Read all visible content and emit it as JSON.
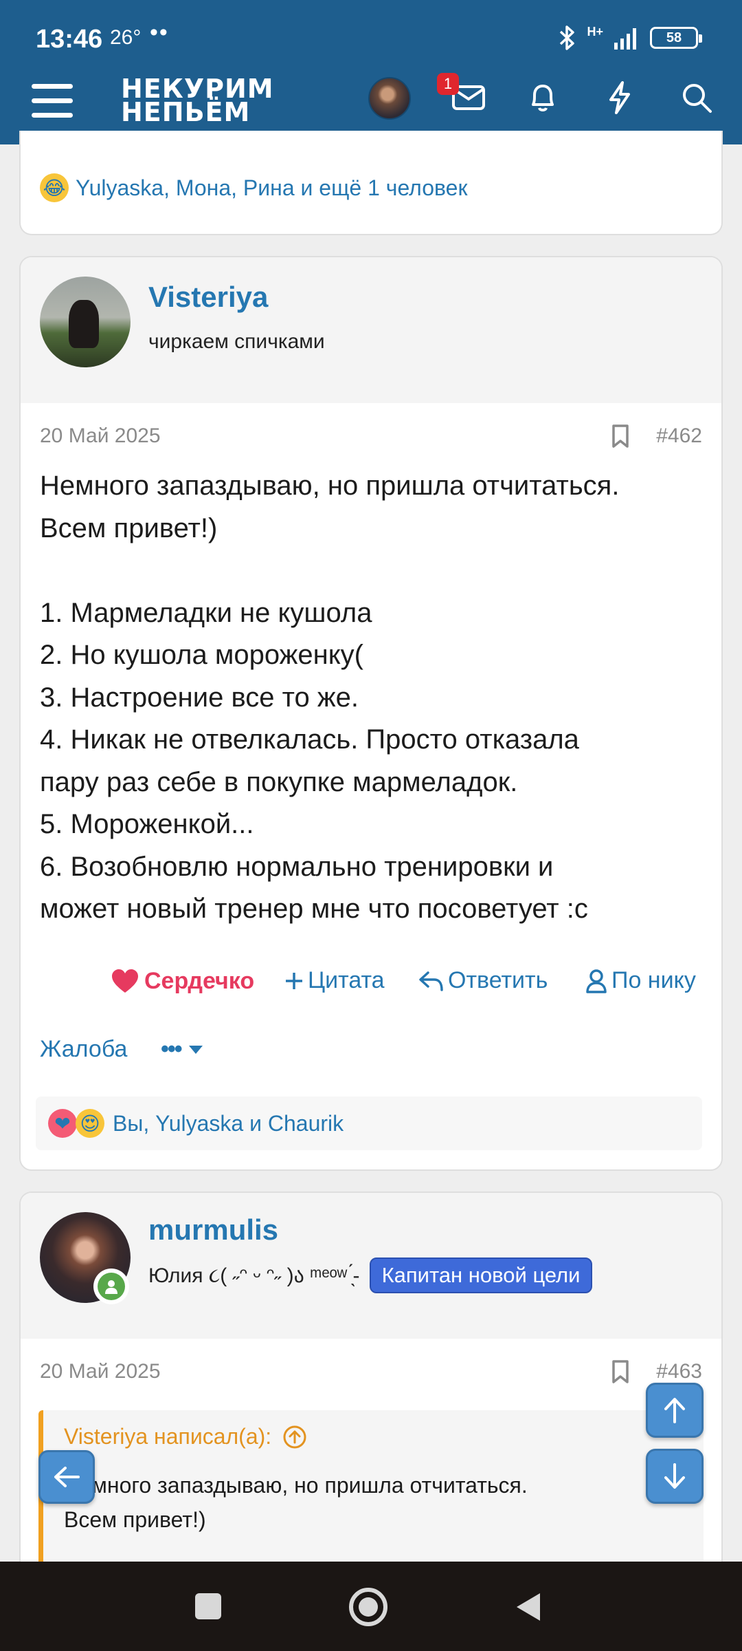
{
  "status": {
    "time": "13:46",
    "temperature": "26°",
    "battery": "58",
    "network": "H+"
  },
  "header": {
    "logo_line1": "НЕКУРИМ",
    "logo_line2": "НЕПЬЁМ",
    "notification_count": "1"
  },
  "prev_post": {
    "reactions_text": "Yulyaska, Мона, Рина и ещё 1 человек"
  },
  "post_462": {
    "username": "Visteriya",
    "user_title": "чиркаем спичками",
    "date": "20 Май 2025",
    "number": "#462",
    "body": "Немного запаздываю, но пришла отчитаться.\nВсем привет!)\n\n1. Мармеладки не кушола\n2. Но кушола мороженку(\n3. Настроение все то же.\n4. Никак не отвелкалась. Просто отказала\nпару раз себе в покупке мармеладок.\n5. Мороженкой...\n6. Возобновлю нормально тренировки и\nможет новый тренер мне что посоветует :с",
    "actions": {
      "like": "Сердечко",
      "quote": "Цитата",
      "reply": "Ответить",
      "by_nick": "По нику",
      "report": "Жалоба"
    },
    "reactions_text": "Вы, Yulyaska и Chaurik"
  },
  "post_463": {
    "username": "murmulis",
    "user_title": "Юлия ૮( ˶ᵔ ᵕ ᵔ˶ )ა ᵐᵉᵒʷ ̖́-",
    "badge": "Капитан новой цели",
    "date": "20 Май 2025",
    "number": "#463",
    "quote_author": "Visteriya написал(а):",
    "quote_text": "Немного запаздываю, но пришла отчитаться.\nВсем привет!)"
  },
  "colors": {
    "header_bg": "#1e5e8e",
    "link": "#2577b1",
    "heart": "#e63a5f",
    "quote_accent": "#f0a020",
    "badge": "#3e6ad9"
  }
}
